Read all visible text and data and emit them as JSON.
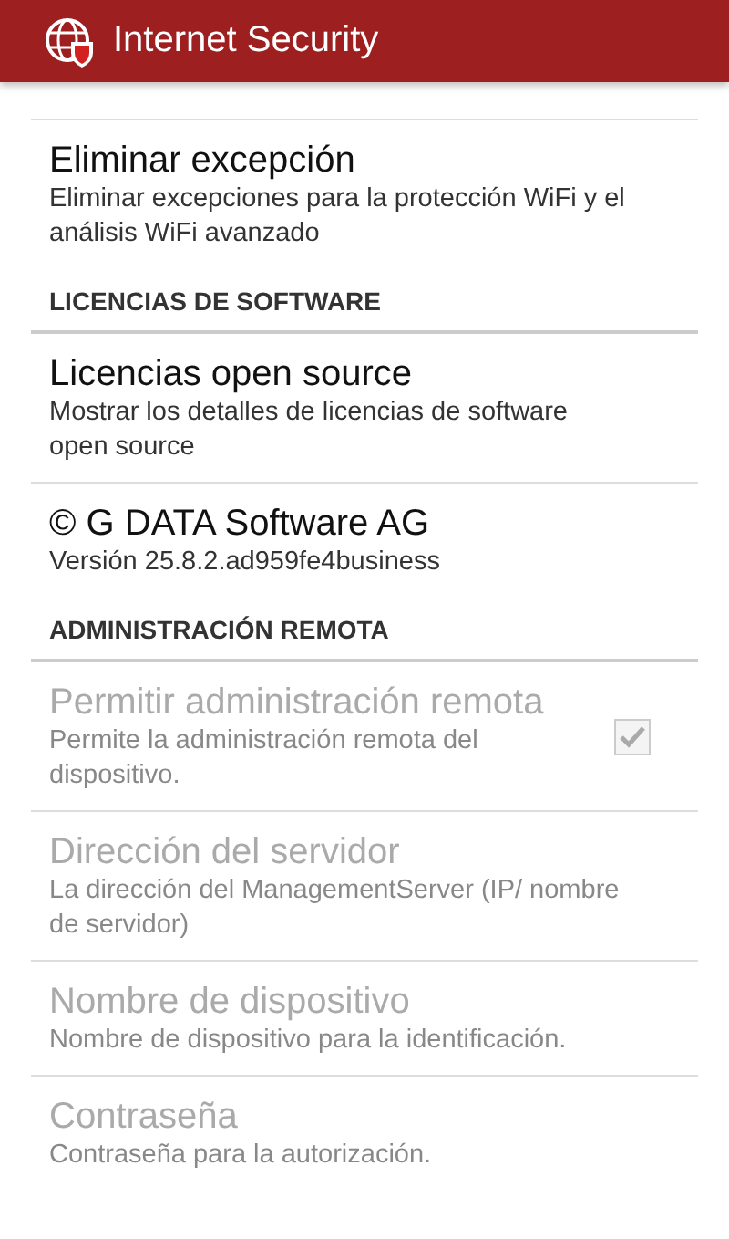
{
  "app_bar": {
    "title": "Internet Security"
  },
  "sections": [
    {
      "items": [
        {
          "kind": "preference",
          "title": "Eliminar excepción",
          "summary": "Eliminar excepciones para la protección WiFi y el análisis WiFi avanzado",
          "disabled": false
        }
      ]
    },
    {
      "header": "LICENCIAS DE SOFTWARE",
      "items": [
        {
          "kind": "preference",
          "title": "Licencias open source",
          "summary": "Mostrar los detalles de licencias de software open source",
          "disabled": false
        },
        {
          "kind": "preference",
          "title": "© G DATA Software AG",
          "summary": "Versión 25.8.2.ad959fe4business",
          "disabled": false
        }
      ]
    },
    {
      "header": "ADMINISTRACIÓN REMOTA",
      "items": [
        {
          "kind": "checkbox",
          "title": "Permitir administración remota",
          "summary": "Permite la administración remota del dispositivo.",
          "disabled": true,
          "checked": true
        },
        {
          "kind": "preference",
          "title": "Dirección del servidor",
          "summary": "La dirección del ManagementServer (IP/ nombre de servidor)",
          "disabled": true
        },
        {
          "kind": "preference",
          "title": "Nombre de dispositivo",
          "summary": "Nombre de dispositivo para la identificación.",
          "disabled": true
        },
        {
          "kind": "preference",
          "title": "Contraseña",
          "summary": "Contraseña para la autorización.",
          "disabled": true
        }
      ]
    }
  ]
}
